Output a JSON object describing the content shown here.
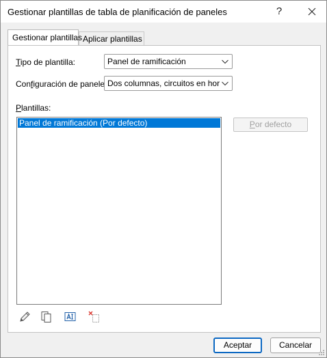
{
  "window": {
    "title": "Gestionar plantillas de tabla de planificación de paneles",
    "help_label": "?",
    "close_label": "✕"
  },
  "tabs": [
    {
      "label": "Gestionar plantillas",
      "active": true
    },
    {
      "label": "Aplicar plantillas",
      "active": false
    }
  ],
  "form": {
    "template_type_label_mnemonic": "T",
    "template_type_label_rest": "ipo de plantilla:",
    "template_type_value": "Panel de ramificación",
    "panel_config_label_pre": "Con",
    "panel_config_label_mnemonic": "f",
    "panel_config_label_rest": "iguración de paneles:",
    "panel_config_value": "Dos columnas, circuitos en horizon",
    "templates_label_mnemonic": "P",
    "templates_label_rest": "lantillas:"
  },
  "templates_list": [
    {
      "label": "Panel de ramificación (Por defecto)",
      "selected": true
    }
  ],
  "buttons": {
    "set_default_mnemonic": "P",
    "set_default_rest": "or defecto",
    "ok_label": "Aceptar",
    "cancel_label": "Cancelar"
  },
  "toolbar_icons": [
    "pencil-edit-icon",
    "duplicate-icon",
    "rename-icon",
    "delete-icon"
  ],
  "colors": {
    "selection": "#0078d7",
    "ok_border": "#0a67c2"
  }
}
